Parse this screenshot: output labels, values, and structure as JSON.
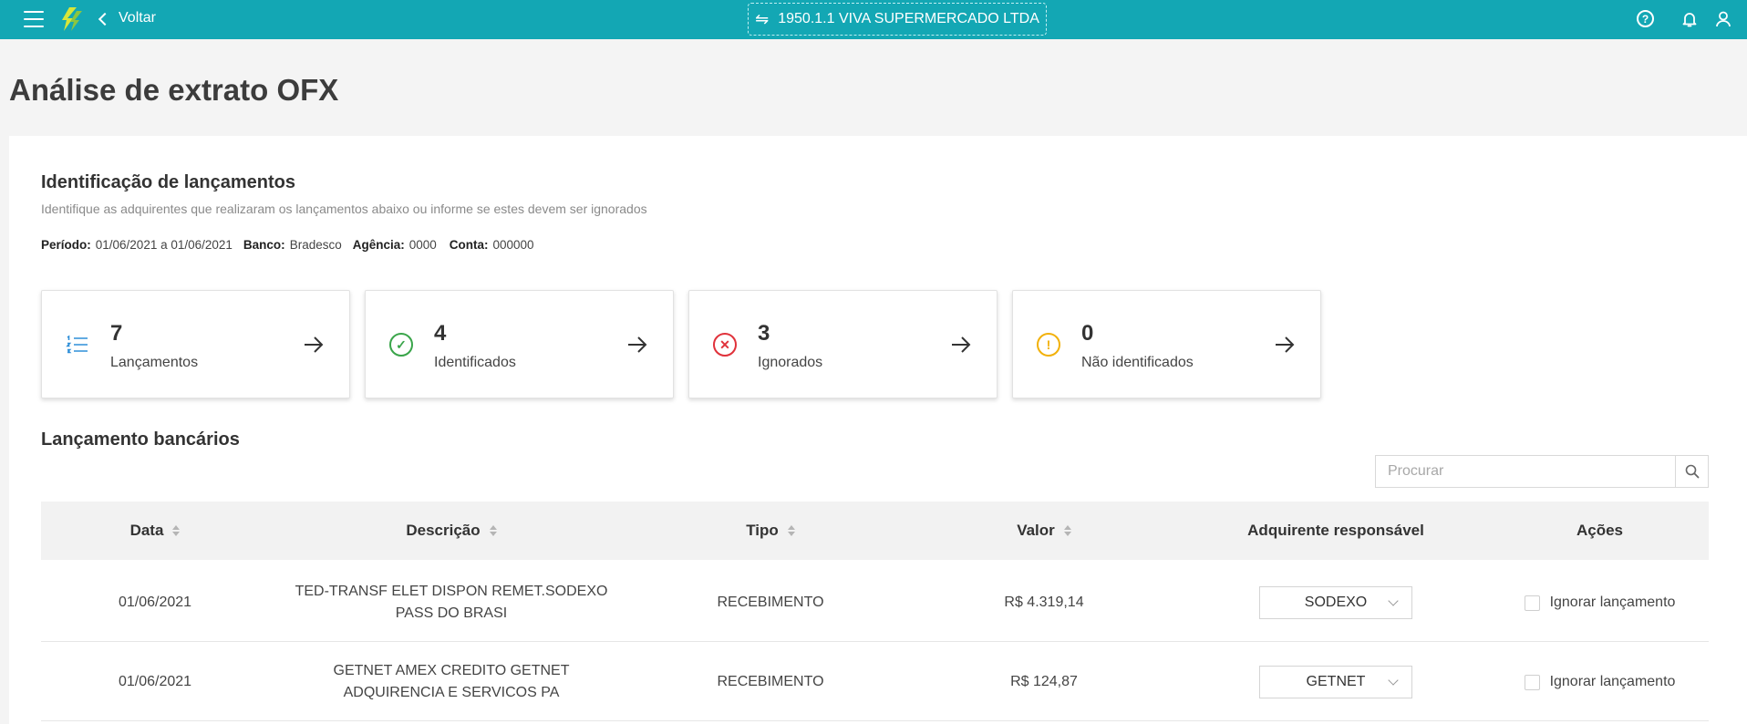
{
  "header": {
    "back_label": "Voltar",
    "company": "1950.1.1 VIVA SUPERMERCADO LTDA",
    "accent_color": "#13a7b4"
  },
  "page": {
    "title": "Análise de extrato OFX"
  },
  "identification": {
    "title": "Identificação de lançamentos",
    "subtitle": "Identifique as adquirentes que realizaram os lançamentos abaixo ou informe se estes devem ser ignorados",
    "period_label": "Período:",
    "period_value": "01/06/2021 a 01/06/2021",
    "bank_label": "Banco:",
    "bank_value": "Bradesco",
    "agency_label": "Agência:",
    "agency_value": "0000",
    "account_label": "Conta:",
    "account_value": "000000"
  },
  "stats": [
    {
      "value": "7",
      "label": "Lançamentos",
      "icon": "list-icon"
    },
    {
      "value": "4",
      "label": "Identificados",
      "icon": "check-circle-icon"
    },
    {
      "value": "3",
      "label": "Ignorados",
      "icon": "x-circle-icon"
    },
    {
      "value": "0",
      "label": "Não identificados",
      "icon": "warning-circle-icon"
    }
  ],
  "table": {
    "title": "Lançamento bancários",
    "search_placeholder": "Procurar",
    "columns": {
      "date": "Data",
      "description": "Descrição",
      "type": "Tipo",
      "value": "Valor",
      "acquirer": "Adquirente responsável",
      "actions": "Ações"
    },
    "rows": [
      {
        "date": "01/06/2021",
        "description_line1": "TED-TRANSF ELET DISPON REMET.SODEXO",
        "description_line2": "PASS DO BRASI",
        "type": "RECEBIMENTO",
        "value": "R$ 4.319,14",
        "acquirer": "SODEXO",
        "ignore_label": "Ignorar lançamento"
      },
      {
        "date": "01/06/2021",
        "description_line1": "GETNET AMEX CREDITO GETNET",
        "description_line2": "ADQUIRENCIA E SERVICOS PA",
        "type": "RECEBIMENTO",
        "value": "R$ 124,87",
        "acquirer": "GETNET",
        "ignore_label": "Ignorar lançamento"
      }
    ]
  }
}
